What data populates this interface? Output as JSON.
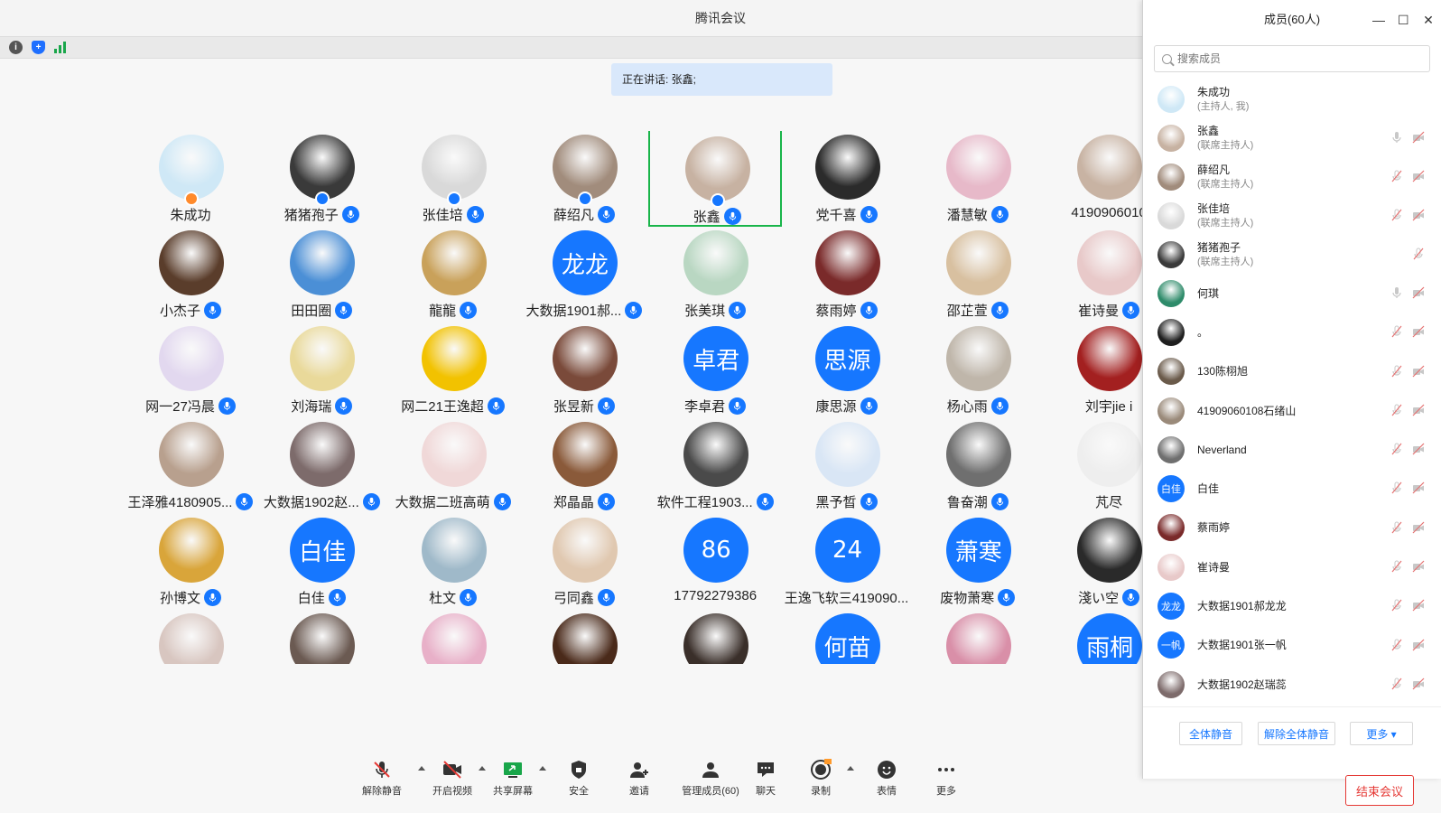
{
  "window": {
    "title": "腾讯会议"
  },
  "info_bar": {
    "icons": [
      "info-icon",
      "shield-icon",
      "signal-icon"
    ]
  },
  "speaking": {
    "text": "正在讲话: 张鑫;"
  },
  "grid": {
    "rows": [
      [
        {
          "name": "朱成功",
          "avatar": "photo-cartoon-boy",
          "badge": "host",
          "mic": false,
          "color": "#cfe8f6"
        },
        {
          "name": "猪猪孢子",
          "avatar": "photo-mickey",
          "badge": "cohost",
          "mic": true,
          "color": "#3a3a3a"
        },
        {
          "name": "张佳培",
          "avatar": "photo-sketch-girl",
          "badge": "cohost",
          "mic": true,
          "color": "#d9d9d9"
        },
        {
          "name": "薛绍凡",
          "avatar": "photo-greatwall",
          "badge": "cohost",
          "mic": true,
          "color": "#a18c7c"
        },
        {
          "name": "张鑫",
          "avatar": "photo-couple",
          "badge": "cohost",
          "mic": true,
          "color": "#c7b2a2",
          "active": true
        },
        {
          "name": "党千喜",
          "avatar": "photo-dark-figure",
          "badge": "",
          "mic": true,
          "color": "#2b2b2b"
        },
        {
          "name": "潘慧敏",
          "avatar": "photo-girl-headband",
          "badge": "",
          "mic": true,
          "color": "#e7b9c9"
        },
        {
          "name": "4190906010",
          "avatar": "photo-baby",
          "badge": "",
          "mic": false,
          "color": "#c8b3a3"
        }
      ],
      [
        {
          "name": "小杰子",
          "avatar": "photo-ron",
          "badge": "",
          "mic": true,
          "color": "#5a3d2b"
        },
        {
          "name": "田田圈",
          "avatar": "photo-donald",
          "badge": "",
          "mic": true,
          "color": "#4b8fd6"
        },
        {
          "name": "龍龍",
          "avatar": "photo-cat-food",
          "badge": "",
          "mic": true,
          "color": "#c9a15a"
        },
        {
          "name": "大数据1901郝...",
          "avatar": "text",
          "avatar_text": "龙龙",
          "badge": "",
          "mic": true,
          "color": "#1677ff"
        },
        {
          "name": "张美琪",
          "avatar": "photo-cartoon-runner",
          "badge": "",
          "mic": true,
          "color": "#b9d7c2"
        },
        {
          "name": "蔡雨婷",
          "avatar": "photo-girl-roses",
          "badge": "",
          "mic": true,
          "color": "#7a2a2a"
        },
        {
          "name": "邵芷萱",
          "avatar": "photo-flowers",
          "badge": "",
          "mic": true,
          "color": "#d8c0a0"
        },
        {
          "name": "崔诗曼",
          "avatar": "photo-baby2",
          "badge": "",
          "mic": true,
          "color": "#e8c9c9"
        }
      ],
      [
        {
          "name": "网一27冯晨",
          "avatar": "photo-anime-girl",
          "badge": "",
          "mic": true,
          "color": "#e2d8ef"
        },
        {
          "name": "刘海瑞",
          "avatar": "photo-deer",
          "badge": "",
          "mic": true,
          "color": "#e9d99a"
        },
        {
          "name": "网二21王逸超",
          "avatar": "photo-basketball",
          "badge": "",
          "mic": true,
          "color": "#f2c200"
        },
        {
          "name": "张昱新",
          "avatar": "photo-man-suit",
          "badge": "",
          "mic": true,
          "color": "#7a4a3a"
        },
        {
          "name": "李卓君",
          "avatar": "text",
          "avatar_text": "卓君",
          "badge": "",
          "mic": true,
          "color": "#1677ff"
        },
        {
          "name": "康思源",
          "avatar": "text",
          "avatar_text": "思源",
          "badge": "",
          "mic": true,
          "color": "#1677ff"
        },
        {
          "name": "杨心雨",
          "avatar": "photo-kid-heart",
          "badge": "",
          "mic": true,
          "color": "#bfb6aa"
        },
        {
          "name": "刘宇jie i",
          "avatar": "photo-red-hair",
          "badge": "",
          "mic": false,
          "color": "#a32020"
        }
      ],
      [
        {
          "name": "王泽雅4180905...",
          "avatar": "photo-girl-selfie",
          "badge": "",
          "mic": true,
          "color": "#b8a08e"
        },
        {
          "name": "大数据1902赵...",
          "avatar": "photo-hinata",
          "badge": "",
          "mic": true,
          "color": "#7d6b6b"
        },
        {
          "name": "大数据二班高萌",
          "avatar": "photo-chibi-girl",
          "badge": "",
          "mic": true,
          "color": "#f0d8d8"
        },
        {
          "name": "郑晶晶",
          "avatar": "photo-bear-santa",
          "badge": "",
          "mic": true,
          "color": "#8a5a3a"
        },
        {
          "name": "软件工程1903...",
          "avatar": "photo-anime-boy",
          "badge": "",
          "mic": true,
          "color": "#4a4a4a"
        },
        {
          "name": "黑予晳",
          "avatar": "photo-anime-blue",
          "badge": "",
          "mic": true,
          "color": "#d9e6f5"
        },
        {
          "name": "鲁奋潮",
          "avatar": "photo-man-mono",
          "badge": "",
          "mic": true,
          "color": "#6f6f6f"
        },
        {
          "name": "芃尽",
          "avatar": "photo-ink-figure",
          "badge": "",
          "mic": false,
          "color": "#eeeeee"
        }
      ],
      [
        {
          "name": "孙博文",
          "avatar": "photo-jojo",
          "badge": "",
          "mic": true,
          "color": "#d9a53a"
        },
        {
          "name": "白佳",
          "avatar": "text",
          "avatar_text": "白佳",
          "badge": "",
          "mic": true,
          "color": "#1677ff"
        },
        {
          "name": "杜文",
          "avatar": "photo-room",
          "badge": "",
          "mic": true,
          "color": "#9fb9c9"
        },
        {
          "name": "弓同鑫",
          "avatar": "photo-naruto",
          "badge": "",
          "mic": true,
          "color": "#e0c8b0"
        },
        {
          "name": "17792279386",
          "avatar": "text",
          "avatar_text": "86",
          "badge": "",
          "mic": false,
          "color": "#1677ff"
        },
        {
          "name": "王逸飞软三419090...",
          "avatar": "text",
          "avatar_text": "24",
          "badge": "",
          "mic": false,
          "color": "#1677ff"
        },
        {
          "name": "废物萧寒",
          "avatar": "text",
          "avatar_text": "萧寒",
          "badge": "",
          "mic": true,
          "color": "#1677ff"
        },
        {
          "name": "淺い空",
          "avatar": "photo-frog",
          "badge": "",
          "mic": true,
          "color": "#2a2a2a"
        }
      ],
      [
        {
          "name": "",
          "avatar": "photo-girl-hat",
          "badge": "",
          "mic": false,
          "color": "#d8c6c0"
        },
        {
          "name": "",
          "avatar": "photo-dark-hair",
          "badge": "",
          "mic": false,
          "color": "#6b5a52"
        },
        {
          "name": "",
          "avatar": "photo-anime-pink",
          "badge": "",
          "mic": false,
          "color": "#e8b0c8"
        },
        {
          "name": "",
          "avatar": "photo-woman-dark",
          "badge": "",
          "mic": false,
          "color": "#4a2a1a"
        },
        {
          "name": "",
          "avatar": "photo-dim",
          "badge": "",
          "mic": false,
          "color": "#3a2f2a"
        },
        {
          "name": "",
          "avatar": "text",
          "avatar_text": "何苗",
          "badge": "",
          "mic": false,
          "color": "#1677ff"
        },
        {
          "name": "",
          "avatar": "photo-cartoon-glasses",
          "badge": "",
          "mic": false,
          "color": "#d98fa8"
        },
        {
          "name": "",
          "avatar": "text",
          "avatar_text": "雨桐",
          "badge": "",
          "mic": false,
          "color": "#1677ff"
        }
      ]
    ]
  },
  "panel": {
    "title": "成员(60人)",
    "search_placeholder": "搜索成员",
    "members": [
      {
        "name": "朱成功",
        "role": "(主持人, 我)",
        "color": "#cfe8f6",
        "avatar_text": "",
        "mic": "none",
        "cam": "none"
      },
      {
        "name": "张鑫",
        "role": "(联席主持人)",
        "color": "#c7b2a2",
        "avatar_text": "",
        "mic": "on",
        "cam": "off"
      },
      {
        "name": "薛绍凡",
        "role": "(联席主持人)",
        "color": "#a18c7c",
        "avatar_text": "",
        "mic": "muted",
        "cam": "off"
      },
      {
        "name": "张佳培",
        "role": "(联席主持人)",
        "color": "#d9d9d9",
        "avatar_text": "",
        "mic": "muted",
        "cam": "off"
      },
      {
        "name": "猪猪孢子",
        "role": "(联席主持人)",
        "color": "#3a3a3a",
        "avatar_text": "",
        "mic": "muted",
        "cam": "none"
      },
      {
        "name": "何琪",
        "role": "",
        "color": "#2e8b6a",
        "avatar_text": "",
        "mic": "on",
        "cam": "off"
      },
      {
        "name": "。",
        "role": "",
        "color": "#1f1f1f",
        "avatar_text": "",
        "mic": "muted",
        "cam": "off"
      },
      {
        "name": "130陈栩旭",
        "role": "",
        "color": "#6a5a4a",
        "avatar_text": "",
        "mic": "muted",
        "cam": "off"
      },
      {
        "name": "41909060108石绪山",
        "role": "",
        "color": "#9a8a7a",
        "avatar_text": "",
        "mic": "muted",
        "cam": "off"
      },
      {
        "name": "Neverland",
        "role": "",
        "color": "#6f6f6f",
        "avatar_text": "",
        "mic": "muted",
        "cam": "off"
      },
      {
        "name": "白佳",
        "role": "",
        "color": "#1677ff",
        "avatar_text": "白佳",
        "mic": "muted",
        "cam": "off"
      },
      {
        "name": "蔡雨婷",
        "role": "",
        "color": "#7a2a2a",
        "avatar_text": "",
        "mic": "muted",
        "cam": "off"
      },
      {
        "name": "崔诗曼",
        "role": "",
        "color": "#e8c9c9",
        "avatar_text": "",
        "mic": "muted",
        "cam": "off"
      },
      {
        "name": "大数据1901郝龙龙",
        "role": "",
        "color": "#1677ff",
        "avatar_text": "龙龙",
        "mic": "muted",
        "cam": "off"
      },
      {
        "name": "大数据1901张一帆",
        "role": "",
        "color": "#1677ff",
        "avatar_text": "一帆",
        "mic": "muted",
        "cam": "off"
      },
      {
        "name": "大数据1902赵瑞蕊",
        "role": "",
        "color": "#7d6b6b",
        "avatar_text": "",
        "mic": "muted",
        "cam": "off"
      }
    ],
    "buttons": {
      "mute_all": "全体静音",
      "unmute_all": "解除全体静音",
      "more": "更多 ▾"
    }
  },
  "toolbar": {
    "unmute": "解除静音",
    "video": "开启视频",
    "share": "共享屏幕",
    "security": "安全",
    "invite": "邀请",
    "members": "管理成员(60)",
    "chat": "聊天",
    "record": "录制",
    "reaction": "表情",
    "more": "更多"
  },
  "end_meeting": "结束会议",
  "colors": {
    "accent": "#1677ff",
    "active_border": "#19b54a",
    "danger": "#e53935"
  }
}
